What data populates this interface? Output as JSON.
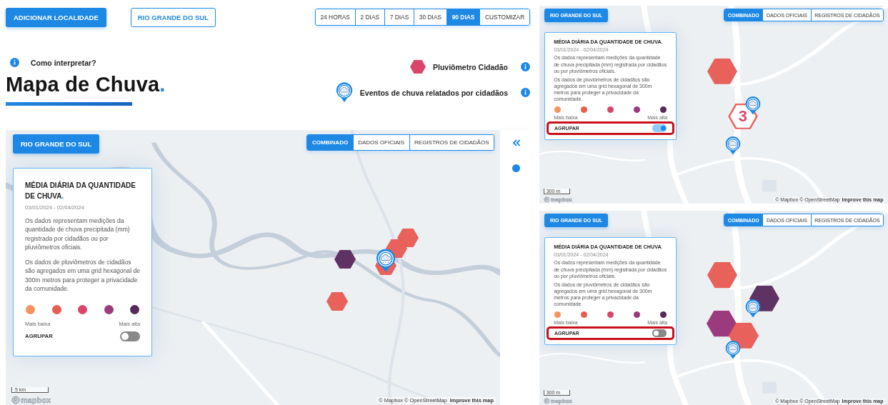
{
  "toolbar": {
    "add_button": "ADICIONAR LOCALIDADE",
    "region_button": "RIO GRANDE DO SUL",
    "periods": [
      {
        "label": "24 HORAS",
        "selected": false
      },
      {
        "label": "2 DIAS",
        "selected": false
      },
      {
        "label": "7 DIAS",
        "selected": false
      },
      {
        "label": "30 DIAS",
        "selected": false
      },
      {
        "label": "90 DIAS",
        "selected": true
      },
      {
        "label": "CUSTOMIZAR",
        "selected": false
      }
    ]
  },
  "header": {
    "help": "Como interpretar?",
    "title": "Mapa de Chuva",
    "title_dot": ".",
    "legend": [
      {
        "kind": "hexagon",
        "label": "Pluviômetro Cidadão",
        "color": "#d9466a"
      },
      {
        "kind": "pin",
        "label": "Eventos de chuva relatados por cidadãos"
      }
    ]
  },
  "maps": [
    {
      "region_button": "RIO GRANDE DO SUL",
      "layers": [
        {
          "label": "COMBINADO",
          "selected": true
        },
        {
          "label": "DADOS OFICIAIS",
          "selected": false
        },
        {
          "label": "REGISTROS DE CIDADÃOS",
          "selected": false
        }
      ],
      "card": {
        "title": "MÉDIA DIÁRIA DA QUANTIDADE DE CHUVA",
        "title_dot": ".",
        "dates": "03/01/2024 - 02/04/2024",
        "paragraphs": [
          "Os dados representam medições da quantidade de chuva precipitada (mm) registrada por cidadãos ou por pluviômetros oficiais.",
          "Os dados de pluviômetros de cidadãos são agregados em uma grid hexagonal de 300m metros para proteger a privacidade da comunidade."
        ],
        "colors": [
          {
            "color": "#f6925f"
          },
          {
            "color": "#e85c52"
          },
          {
            "color": "#d9466a"
          },
          {
            "color": "#9b3b7e"
          },
          {
            "color": "#572a5a"
          }
        ],
        "low": "Mais baixa",
        "high": "Mais alta",
        "group_label": "AGRUPAR",
        "group_on": false,
        "highlighted": false
      },
      "markers": [
        {
          "kind": "hexagon",
          "color": "#5e3262"
        },
        {
          "kind": "hexagon",
          "color": "#e8615a"
        },
        {
          "kind": "hexagon",
          "color": "#e8615a"
        },
        {
          "kind": "hexagon",
          "color": "#e8615a"
        },
        {
          "kind": "hexagon",
          "color": "#e8615a"
        },
        {
          "kind": "pin"
        }
      ],
      "scale": "5 km",
      "logo": "mapbox",
      "attribution": "© Mapbox © OpenStreetMap",
      "improve": "Improve this map"
    },
    {
      "region_button": "RIO GRANDE DO SUL",
      "layers": [
        {
          "label": "COMBINADO",
          "selected": true
        },
        {
          "label": "DADOS OFICIAIS",
          "selected": false
        },
        {
          "label": "REGISTROS DE CIDADÃOS",
          "selected": false
        }
      ],
      "card": {
        "title": "MÉDIA DIÁRIA DA QUANTIDADE DE CHUVA",
        "title_dot": ".",
        "dates": "03/01/2024 - 02/04/2024",
        "paragraphs": [
          "Os dados representam medições da quantidade de chuva precipitada (mm) registrada por cidadãos ou por pluviômetros oficiais.",
          "Os dados de pluviômetros de cidadãos são agregados em uma grid hexagonal de 300m metros para proteger a privacidade da comunidade."
        ],
        "colors": [
          {
            "color": "#f6925f"
          },
          {
            "color": "#e85c52"
          },
          {
            "color": "#d9466a"
          },
          {
            "color": "#9b3b7e"
          },
          {
            "color": "#572a5a"
          }
        ],
        "low": "Mais baixa",
        "high": "Mais alta",
        "group_label": "AGRUPAR",
        "group_on": true,
        "highlighted": true
      },
      "markers": [
        {
          "kind": "hexagon",
          "color": "#e8615a"
        },
        {
          "kind": "cluster",
          "count": "3"
        },
        {
          "kind": "pin"
        },
        {
          "kind": "pin"
        }
      ],
      "scale": "300 m",
      "logo": "mapbox",
      "attribution": "© Mapbox © OpenStreetMap",
      "improve": "Improve this map"
    },
    {
      "region_button": "RIO GRANDE DO SUL",
      "layers": [
        {
          "label": "COMBINADO",
          "selected": true
        },
        {
          "label": "DADOS OFICIAIS",
          "selected": false
        },
        {
          "label": "REGISTROS DE CIDADÃOS",
          "selected": false
        }
      ],
      "card": {
        "title": "MÉDIA DIÁRIA DA QUANTIDADE DE CHUVA",
        "title_dot": ".",
        "dates": "03/01/2024 - 02/04/2024",
        "paragraphs": [
          "Os dados representam medições da quantidade de chuva precipitada (mm) registrada por cidadãos ou por pluviômetros oficiais.",
          "Os dados de pluviômetros de cidadãos são agregados em uma grid hexagonal de 300m metros para proteger a privacidade da comunidade."
        ],
        "colors": [
          {
            "color": "#f6925f"
          },
          {
            "color": "#e85c52"
          },
          {
            "color": "#d9466a"
          },
          {
            "color": "#9b3b7e"
          },
          {
            "color": "#572a5a"
          }
        ],
        "low": "Mais baixa",
        "high": "Mais alta",
        "group_label": "AGRUPAR",
        "group_on": false,
        "highlighted": true
      },
      "markers": [
        {
          "kind": "hexagon",
          "color": "#e8615a"
        },
        {
          "kind": "hexagon",
          "color": "#5e3262"
        },
        {
          "kind": "hexagon",
          "color": "#9b3b7e"
        },
        {
          "kind": "hexagon",
          "color": "#e8615a"
        },
        {
          "kind": "pin"
        },
        {
          "kind": "pin"
        }
      ],
      "scale": "300 m",
      "logo": "mapbox",
      "attribution": "© Mapbox © OpenStreetMap",
      "improve": "Improve this map"
    }
  ]
}
